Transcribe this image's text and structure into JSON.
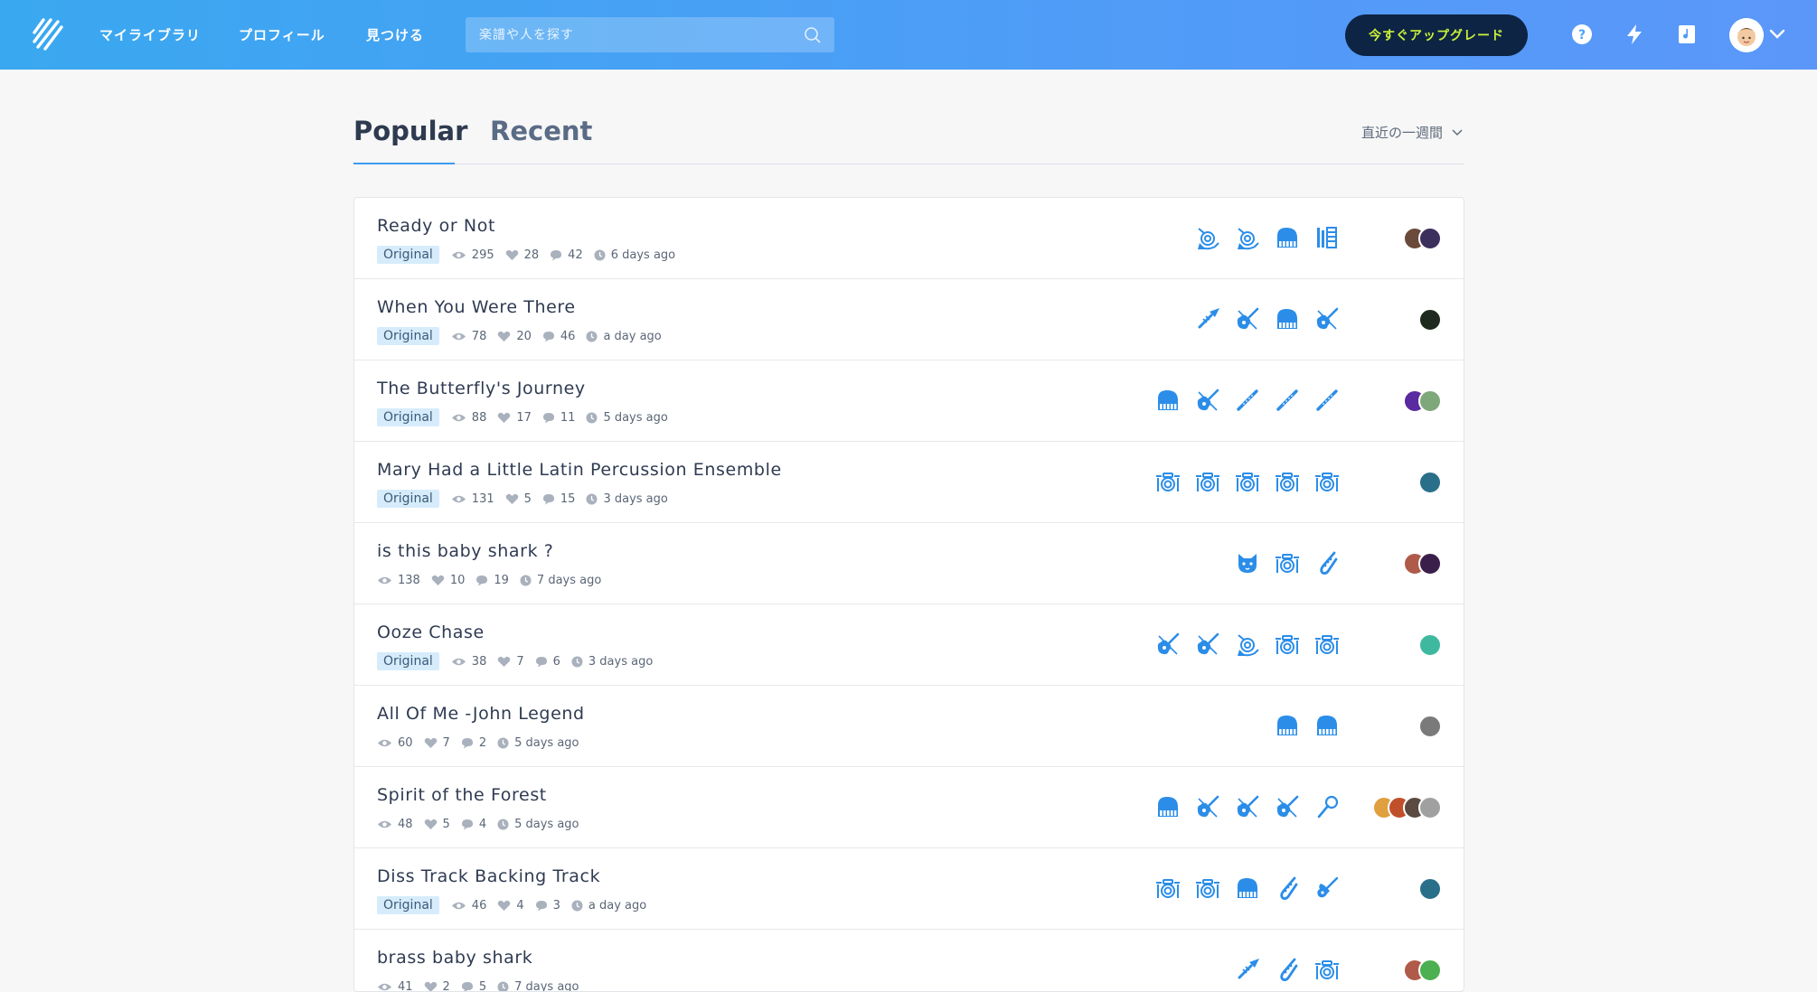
{
  "header": {
    "nav": {
      "library": "マイライブラリ",
      "profile": "プロフィール",
      "discover": "見つける"
    },
    "search_placeholder": "楽譜や人を探す",
    "upgrade_label": "今すぐアップグレード",
    "icons": [
      "logo-icon",
      "search-icon",
      "help-icon",
      "lightning-icon",
      "songbook-icon",
      "user-avatar",
      "chevron-down-icon"
    ]
  },
  "tabs": {
    "popular": "Popular",
    "recent": "Recent",
    "period": "直近の一週間"
  },
  "colors": {
    "accent": "#3d9af2",
    "header_start": "#3aa8f0",
    "header_end": "#5b97f9",
    "upgrade_bg": "#0d2444",
    "upgrade_text": "#c9f23a",
    "badge_bg": "#d6ecfb"
  },
  "scores": [
    {
      "title": "Ready or Not",
      "badge": "Original",
      "views": "295",
      "likes": "28",
      "comments": "42",
      "time": "6 days ago",
      "instruments": [
        "french-horn",
        "french-horn",
        "piano",
        "marimba"
      ],
      "avatars": [
        "#6a4a3a",
        "#3b2f5e"
      ]
    },
    {
      "title": "When You Were There",
      "badge": "Original",
      "views": "78",
      "likes": "20",
      "comments": "46",
      "time": "a day ago",
      "instruments": [
        "trumpet",
        "guitar",
        "piano",
        "guitar"
      ],
      "avatars": [
        "#1e2a1e"
      ]
    },
    {
      "title": "The Butterfly's Journey",
      "badge": "Original",
      "views": "88",
      "likes": "17",
      "comments": "11",
      "time": "5 days ago",
      "instruments": [
        "piano",
        "guitar",
        "flute",
        "flute",
        "flute"
      ],
      "avatars": [
        "#5a2aa0",
        "#7fa87a"
      ]
    },
    {
      "title": "Mary Had a Little Latin Percussion Ensemble",
      "badge": "Original",
      "views": "131",
      "likes": "5",
      "comments": "15",
      "time": "3 days ago",
      "instruments": [
        "drums",
        "drums",
        "drums",
        "drums",
        "drums"
      ],
      "avatars": [
        "#2a6f8a"
      ]
    },
    {
      "title": "is this baby shark ?",
      "badge": "",
      "views": "138",
      "likes": "10",
      "comments": "19",
      "time": "7 days ago",
      "instruments": [
        "cat",
        "drums",
        "saxophone"
      ],
      "avatars": [
        "#b05a4a",
        "#3a1f4a"
      ]
    },
    {
      "title": "Ooze Chase",
      "badge": "Original",
      "views": "38",
      "likes": "7",
      "comments": "6",
      "time": "3 days ago",
      "instruments": [
        "guitar",
        "guitar",
        "french-horn",
        "drums",
        "drums"
      ],
      "avatars": [
        "#3fb8a0"
      ]
    },
    {
      "title": "All Of Me -John Legend",
      "badge": "",
      "views": "60",
      "likes": "7",
      "comments": "2",
      "time": "5 days ago",
      "instruments": [
        "piano",
        "piano"
      ],
      "avatars": [
        "#7a7a7a"
      ]
    },
    {
      "title": "Spirit of the Forest",
      "badge": "",
      "views": "48",
      "likes": "5",
      "comments": "4",
      "time": "5 days ago",
      "instruments": [
        "piano",
        "guitar",
        "guitar",
        "guitar",
        "microphone"
      ],
      "avatars": [
        "#e0a040",
        "#c0502a",
        "#5a4a40",
        "#a0a0a0"
      ]
    },
    {
      "title": "Diss Track Backing Track",
      "badge": "Original",
      "views": "46",
      "likes": "4",
      "comments": "3",
      "time": "a day ago",
      "instruments": [
        "drums",
        "drums",
        "piano",
        "saxophone",
        "electric-guitar"
      ],
      "avatars": [
        "#2a6f8a"
      ]
    },
    {
      "title": "brass baby shark",
      "badge": "",
      "views": "41",
      "likes": "2",
      "comments": "5",
      "time": "7 days ago",
      "instruments": [
        "trumpet",
        "saxophone",
        "drums"
      ],
      "avatars": [
        "#b05a4a",
        "#4caf50"
      ]
    }
  ]
}
